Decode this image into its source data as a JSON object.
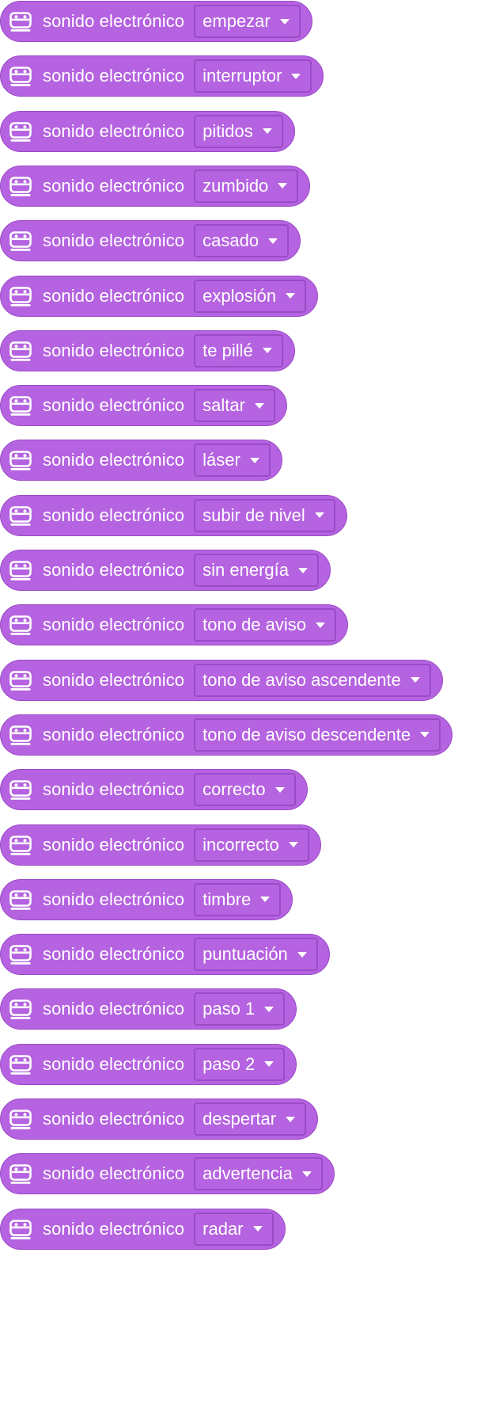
{
  "block_label": "sonido electrónico",
  "block_icon": "microbit-icon",
  "block_color": "#b563e0",
  "block_border_color": "#9b4ac8",
  "blocks": [
    {
      "selected": "empezar"
    },
    {
      "selected": "interruptor"
    },
    {
      "selected": "pitidos"
    },
    {
      "selected": "zumbido"
    },
    {
      "selected": "casado"
    },
    {
      "selected": "explosión"
    },
    {
      "selected": "te pillé"
    },
    {
      "selected": "saltar"
    },
    {
      "selected": "láser"
    },
    {
      "selected": "subir de nivel"
    },
    {
      "selected": "sin energía"
    },
    {
      "selected": "tono de aviso"
    },
    {
      "selected": "tono de aviso ascendente"
    },
    {
      "selected": "tono de aviso descendente"
    },
    {
      "selected": "correcto"
    },
    {
      "selected": "incorrecto"
    },
    {
      "selected": "timbre"
    },
    {
      "selected": "puntuación"
    },
    {
      "selected": "paso 1"
    },
    {
      "selected": "paso 2"
    },
    {
      "selected": "despertar"
    },
    {
      "selected": "advertencia"
    },
    {
      "selected": "radar"
    }
  ]
}
